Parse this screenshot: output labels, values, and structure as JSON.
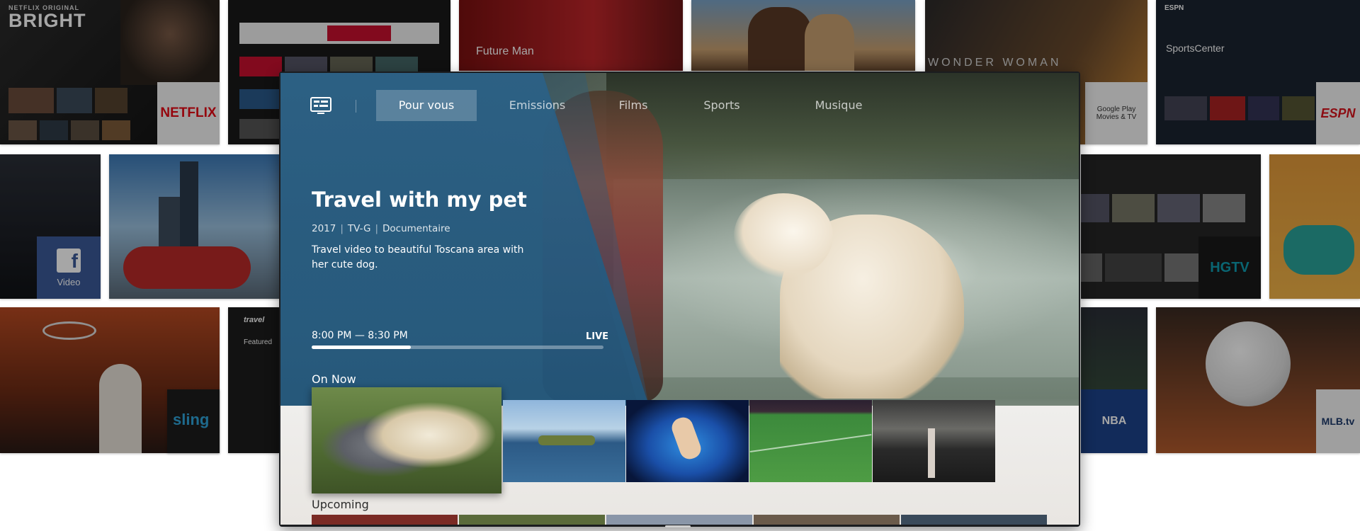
{
  "background": {
    "tiles": {
      "netflix_original": "NETFLIX ORIGINAL",
      "bright": "BRIGHT",
      "netflix_logo": "NETFLIX",
      "future_man": "Future Man",
      "espn_small": "ESPN",
      "sportscenter": "SportsCenter",
      "wonder_woman": "WONDER WOMAN",
      "google_play": "Google Play Movies & TV",
      "espn_logo": "ESPN",
      "facebook_video": "Video",
      "hgtv": "HGTV",
      "travel": "travel",
      "featured": "Featured",
      "sling": "sling",
      "nba": "NBA",
      "mlb": "MLB.tv"
    }
  },
  "nav": {
    "tabs": [
      {
        "label": "Pour vous",
        "active": true
      },
      {
        "label": "Emissions",
        "active": false
      },
      {
        "label": "Films",
        "active": false
      },
      {
        "label": "Sports",
        "active": false
      },
      {
        "label": "Musique",
        "active": false
      }
    ]
  },
  "program": {
    "title": "Travel with my pet",
    "year": "2017",
    "rating": "TV-G",
    "genre": "Documentaire",
    "description": "Travel video to beautiful Toscana area with her cute dog.",
    "time": "8:00 PM — 8:30 PM",
    "live_label": "LIVE",
    "progress": 0.34
  },
  "sections": {
    "on_now": "On Now",
    "upcoming": "Upcoming"
  },
  "thumbnails": [
    {
      "name": "travel-with-pet"
    },
    {
      "name": "floating-islands"
    },
    {
      "name": "dancer-blue-smoke"
    },
    {
      "name": "soccer-match"
    },
    {
      "name": "fashion-show"
    }
  ],
  "colors": {
    "panel_blue": "#2c6186",
    "accent_white": "#ffffff",
    "netflix_red": "#e50914",
    "espn_red": "#d8141e",
    "hgtv_teal": "#0f9bb0",
    "nba_blue": "#1d428a"
  }
}
